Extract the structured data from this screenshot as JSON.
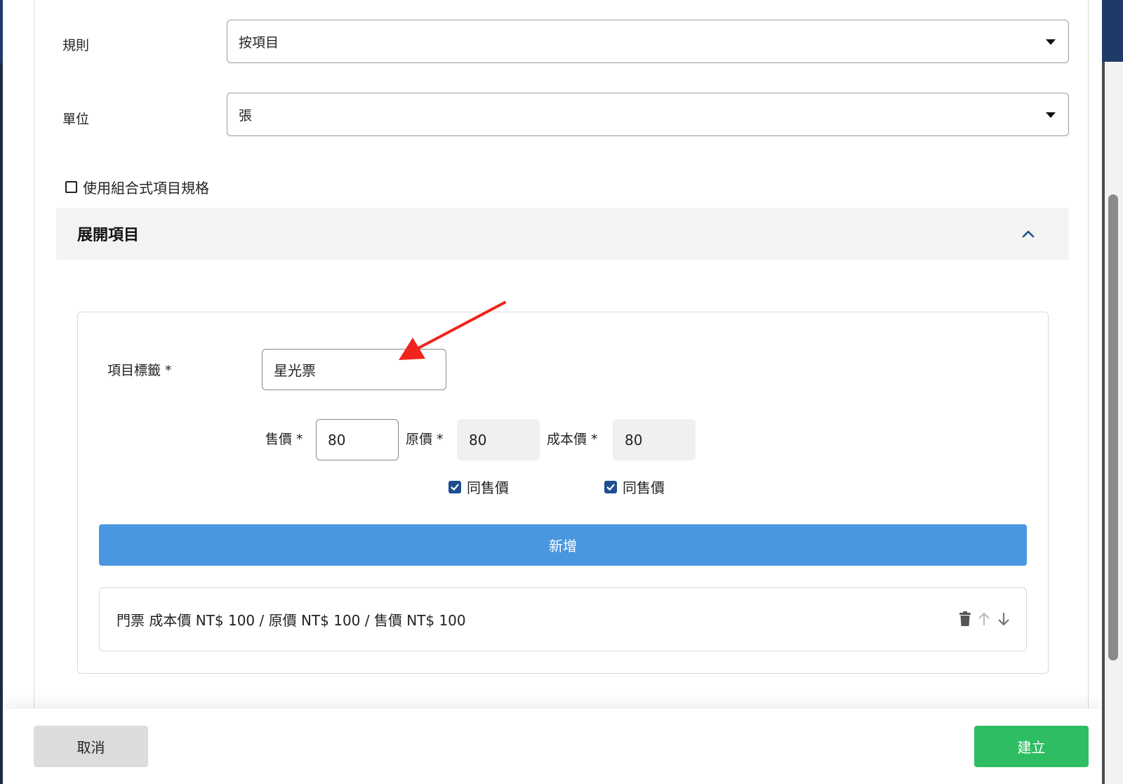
{
  "form": {
    "rule_label": "規則",
    "rule_value": "按項目",
    "unit_label": "單位",
    "unit_value": "張",
    "combo_spec_label": "使用組合式項目規格"
  },
  "accordion": {
    "title": "展開項目"
  },
  "item_editor": {
    "tag_label": "項目標籤 *",
    "tag_value": "星光票",
    "sale_price_label": "售價 *",
    "sale_price_value": "80",
    "original_price_label": "原價 *",
    "original_price_value": "80",
    "cost_price_label": "成本價 *",
    "cost_price_value": "80",
    "same_as_sale_1": "同售價",
    "same_as_sale_2": "同售價",
    "add_label": "新增"
  },
  "items": [
    {
      "text": "門票 成本價 NT$ 100 / 原價 NT$ 100 / 售價 NT$ 100"
    }
  ],
  "footer": {
    "cancel_label": "取消",
    "create_label": "建立"
  },
  "colors": {
    "primary_blue": "#4a97e0",
    "checkbox_blue": "#1d4f8f",
    "create_green": "#2fbd63",
    "annotation_red": "#f0241c"
  }
}
